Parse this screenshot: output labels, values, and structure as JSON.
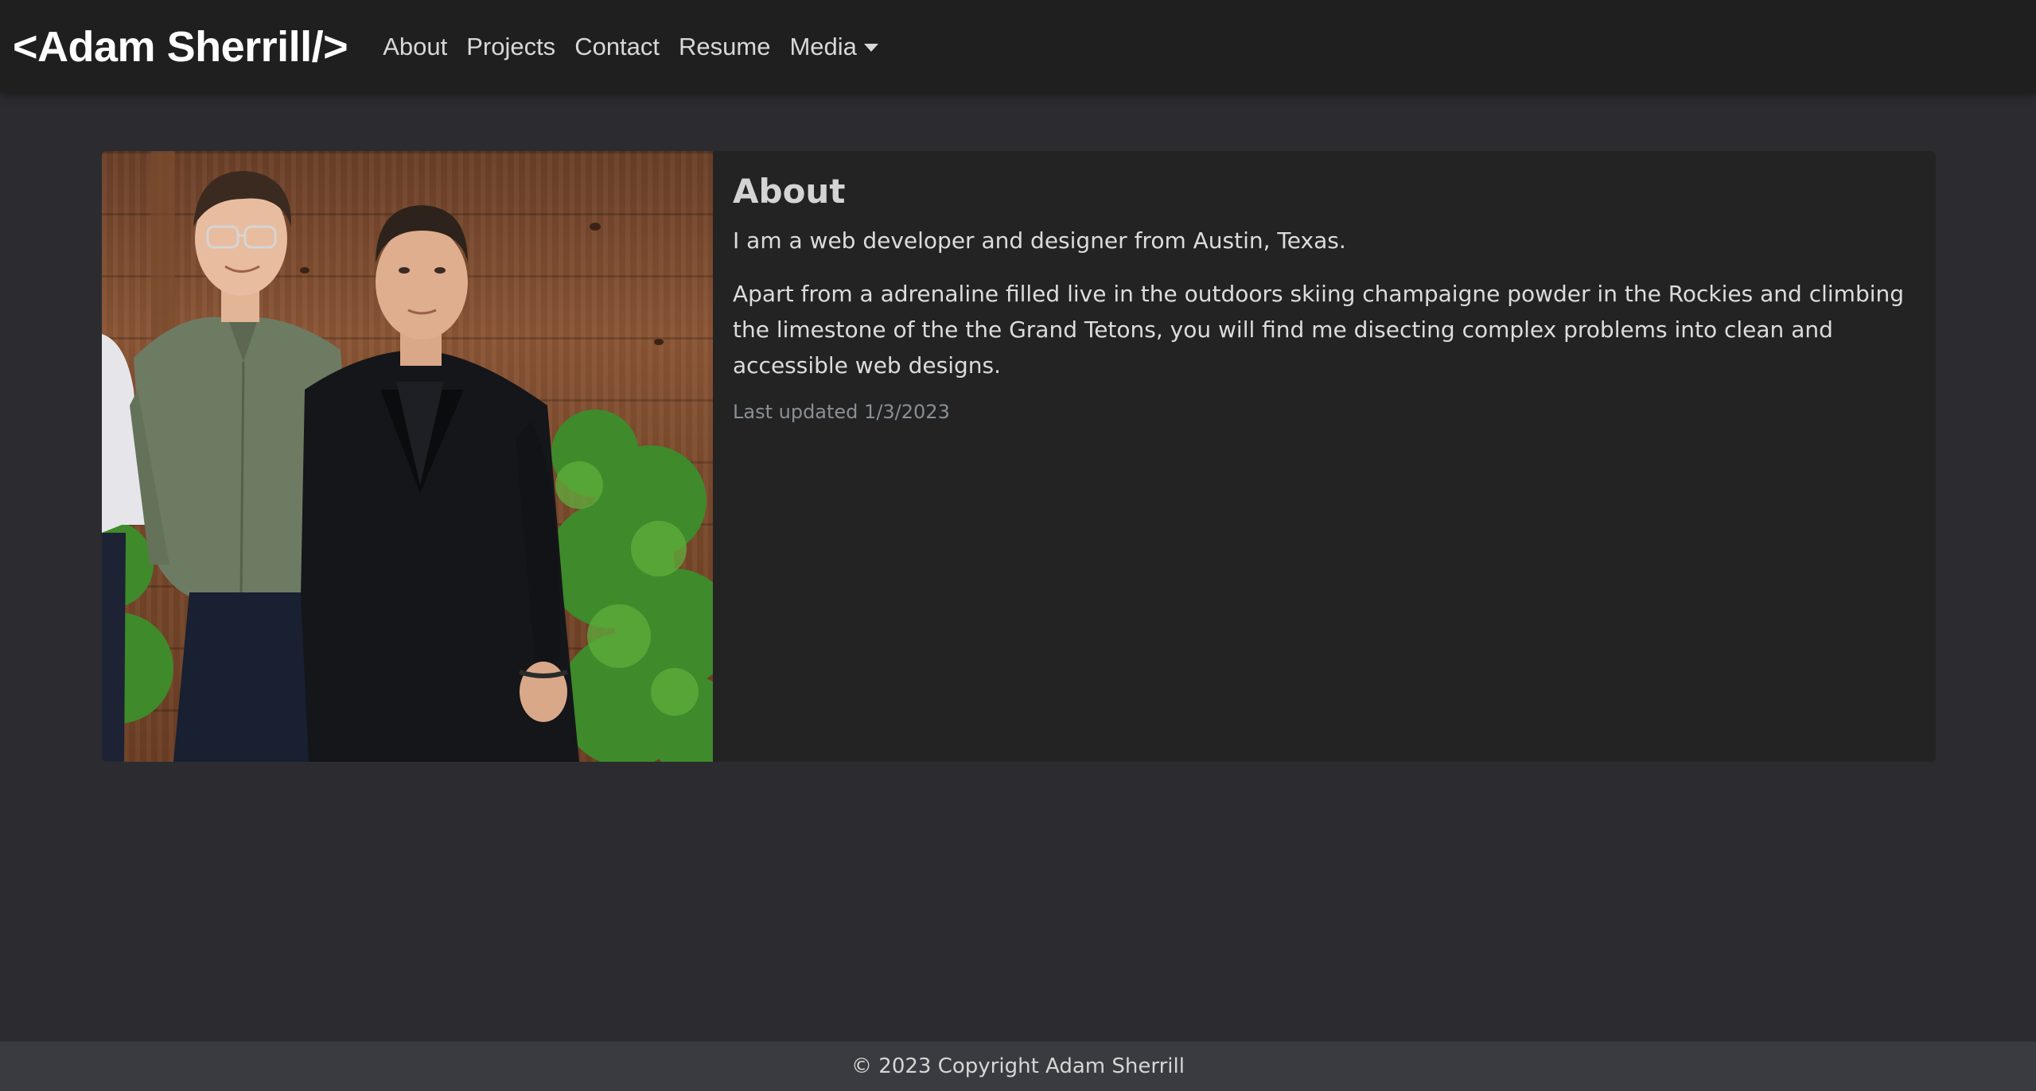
{
  "navbar": {
    "brand": "<Adam Sherrill/>",
    "links": [
      {
        "label": "About"
      },
      {
        "label": "Projects"
      },
      {
        "label": "Contact"
      },
      {
        "label": "Resume"
      }
    ],
    "dropdown": {
      "label": "Media",
      "icon": "caret-down-icon"
    }
  },
  "about": {
    "image_subject": "photo-two-men",
    "title": "About",
    "intro": "I am a web developer and designer from Austin, Texas.",
    "body": "Apart from a adrenaline filled live in the outdoors skiing champaigne powder in the Rockies and climbing the limestone of the the Grand Tetons, you will find me disecting complex problems into clean and accessible web designs.",
    "updated": "Last updated 1/3/2023"
  },
  "footer": {
    "copyright": "© 2023 Copyright Adam Sherrill"
  },
  "colors": {
    "navbar_bg": "#1f1f1f",
    "page_bg": "#2c2c30",
    "card_bg": "#232323",
    "footer_bg": "#3a3a41",
    "muted_text": "#8a8f96"
  }
}
